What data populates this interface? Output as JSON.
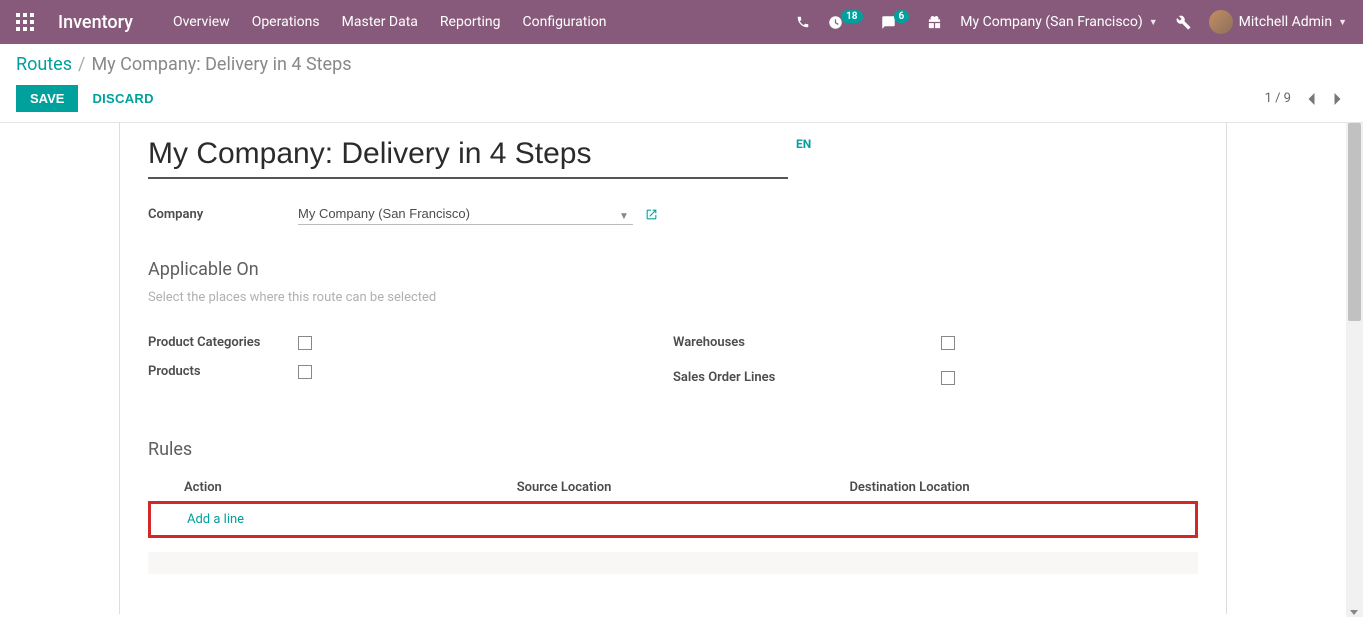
{
  "nav": {
    "brand": "Inventory",
    "menu": [
      "Overview",
      "Operations",
      "Master Data",
      "Reporting",
      "Configuration"
    ],
    "badge_activities": "18",
    "badge_messages": "6",
    "company": "My Company (San Francisco)",
    "user": "Mitchell Admin"
  },
  "breadcrumb": {
    "root": "Routes",
    "current": "My Company: Delivery in 4 Steps"
  },
  "buttons": {
    "save": "SAVE",
    "discard": "DISCARD"
  },
  "pager": {
    "text": "1 / 9"
  },
  "form": {
    "title": "My Company: Delivery in 4 Steps",
    "lang_tag": "EN",
    "company_label": "Company",
    "company_value": "My Company (San Francisco)",
    "applicable_title": "Applicable On",
    "applicable_sub": "Select the places where this route can be selected",
    "checks": {
      "product_categories": "Product Categories",
      "products": "Products",
      "warehouses": "Warehouses",
      "sales_order_lines": "Sales Order Lines"
    },
    "rules_title": "Rules",
    "rules_columns": {
      "action": "Action",
      "source": "Source Location",
      "dest": "Destination Location"
    },
    "add_line": "Add a line"
  }
}
